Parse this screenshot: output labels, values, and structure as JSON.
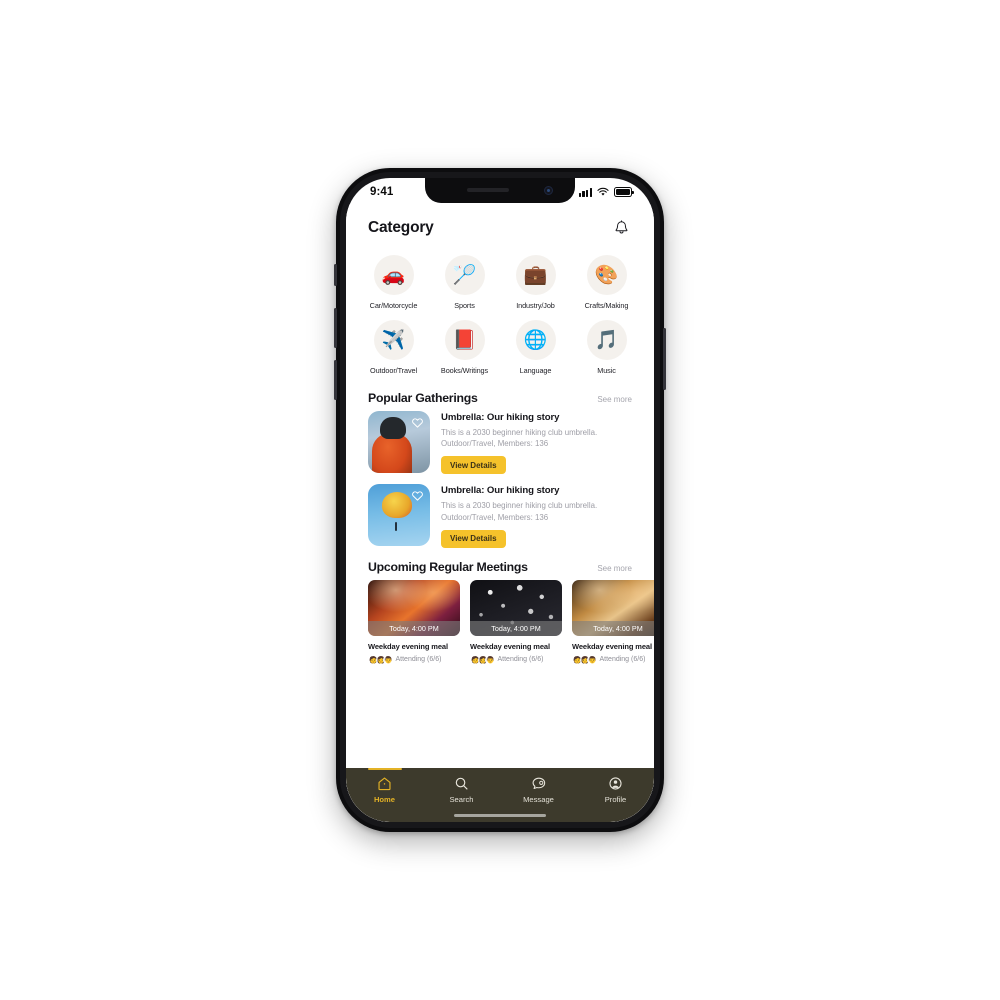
{
  "status_bar": {
    "time": "9:41",
    "signal_icon": "cellular-signal-icon",
    "wifi_icon": "wifi-icon",
    "battery_icon": "battery-icon"
  },
  "header": {
    "title": "Category",
    "bell_icon": "notification-bell-icon"
  },
  "categories": [
    {
      "label": "Car/Motorcycle",
      "icon": "car-icon",
      "glyph": "🚗"
    },
    {
      "label": "Sports",
      "icon": "sports-icon",
      "glyph": "🏸"
    },
    {
      "label": "Industry/Job",
      "icon": "briefcase-icon",
      "glyph": "💼"
    },
    {
      "label": "Crafts/Making",
      "icon": "palette-icon",
      "glyph": "🎨"
    },
    {
      "label": "Outdoor/Travel",
      "icon": "airplane-icon",
      "glyph": "✈️"
    },
    {
      "label": "Books/Writings",
      "icon": "book-icon",
      "glyph": "📕"
    },
    {
      "label": "Language",
      "icon": "translate-icon",
      "glyph": "🌐"
    },
    {
      "label": "Music",
      "icon": "music-note-icon",
      "glyph": "🎵"
    }
  ],
  "popular": {
    "section_title": "Popular Gatherings",
    "see_more": "See more",
    "cards": [
      {
        "title": "Umbrella: Our hiking story",
        "desc_line1": "This is a 2030 beginner hiking club umbrella.",
        "desc_line2": "Outdoor/Travel, Members: 136",
        "button": "View Details",
        "favorite_icon": "heart-outline-icon",
        "thumb": "hiker-photo"
      },
      {
        "title": "Umbrella: Our hiking story",
        "desc_line1": "This is a 2030 beginner hiking club umbrella.",
        "desc_line2": "Outdoor/Travel, Members: 136",
        "button": "View Details",
        "favorite_icon": "heart-outline-icon",
        "thumb": "paraglider-photo"
      }
    ]
  },
  "upcoming": {
    "section_title": "Upcoming Regular Meetings",
    "see_more": "See more",
    "cards": [
      {
        "time": "Today, 4:00 PM",
        "name": "Weekday evening meal",
        "attending": "Attending (6/6)",
        "thumb": "concert-photo-red",
        "avatars": [
          "🧑",
          "👩",
          "👨"
        ]
      },
      {
        "time": "Today, 4:00 PM",
        "name": "Weekday evening meal",
        "attending": "Attending (6/6)",
        "thumb": "confetti-photo-dark",
        "avatars": [
          "🧑",
          "👩",
          "👨"
        ]
      },
      {
        "time": "Today, 4:00 PM",
        "name": "Weekday evening meal",
        "attending": "Attending (6/6)",
        "thumb": "stage-photo-gold",
        "avatars": [
          "🧑",
          "👩",
          "👨"
        ]
      }
    ]
  },
  "tabbar": {
    "active": "Home",
    "items": [
      {
        "label": "Home",
        "icon": "home-icon"
      },
      {
        "label": "Search",
        "icon": "search-icon"
      },
      {
        "label": "Message",
        "icon": "message-icon"
      },
      {
        "label": "Profile",
        "icon": "profile-icon"
      }
    ]
  },
  "colors": {
    "accent_yellow": "#f5c22b",
    "tabbar_bg": "#3d3a2c",
    "tab_active": "#e3b226",
    "category_circle_bg": "#f4f1ed",
    "muted_text": "#9e9ea6"
  }
}
